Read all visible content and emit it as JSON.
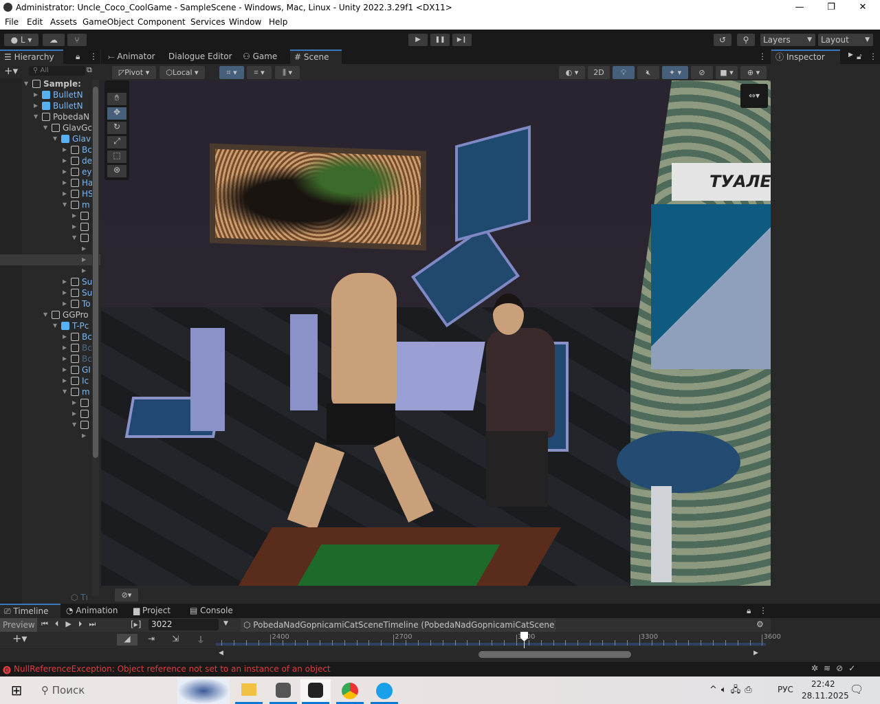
{
  "window": {
    "title": "Administrator: Uncle_Coco_CoolGame - SampleScene - Windows, Mac, Linux - Unity 2022.3.29f1 <DX11>",
    "minimize": "—",
    "maximize": "❐",
    "close": "✕"
  },
  "menu": [
    "File",
    "Edit",
    "Assets",
    "GameObject",
    "Component",
    "Services",
    "Window",
    "Help"
  ],
  "toolbar": {
    "account": "L",
    "layers": "Layers",
    "layout": "Layout",
    "play": "▶",
    "pause": "❚❚",
    "step": "▶❙"
  },
  "hierarchy": {
    "tab": "Hierarchy",
    "search_placeholder": "All",
    "rows": [
      {
        "t": "Sample:",
        "d": 0,
        "k": "scene"
      },
      {
        "t": "BulletN",
        "d": 1,
        "k": "prefab",
        "c": "blue"
      },
      {
        "t": "BulletN",
        "d": 1,
        "k": "prefab",
        "c": "blue"
      },
      {
        "t": "PobedaN",
        "d": 1,
        "k": "obj"
      },
      {
        "t": "GlavGc",
        "d": 2,
        "k": "obj"
      },
      {
        "t": "Glav",
        "d": 3,
        "k": "prefab",
        "c": "blue"
      },
      {
        "t": "Bc",
        "d": 4,
        "k": "obj",
        "c": "blue"
      },
      {
        "t": "de",
        "d": 4,
        "k": "obj",
        "c": "blue"
      },
      {
        "t": "ey",
        "d": 4,
        "k": "obj",
        "c": "blue"
      },
      {
        "t": "Ha",
        "d": 4,
        "k": "obj",
        "c": "blue"
      },
      {
        "t": "HS",
        "d": 4,
        "k": "obj",
        "c": "blue"
      },
      {
        "t": "m",
        "d": 4,
        "k": "obj",
        "c": "blue"
      },
      {
        "t": "",
        "d": 5,
        "k": "obj"
      },
      {
        "t": "",
        "d": 5,
        "k": "obj"
      },
      {
        "t": "",
        "d": 5,
        "k": "obj"
      },
      {
        "t": "",
        "d": 6,
        "k": "none"
      },
      {
        "t": "",
        "d": 6,
        "k": "none",
        "sel": true
      },
      {
        "t": "",
        "d": 6,
        "k": "none"
      },
      {
        "t": "Su",
        "d": 4,
        "k": "obj",
        "c": "blue"
      },
      {
        "t": "Su",
        "d": 4,
        "k": "obj",
        "c": "blue"
      },
      {
        "t": "To",
        "d": 4,
        "k": "obj",
        "c": "blue"
      },
      {
        "t": "GGPro",
        "d": 2,
        "k": "obj"
      },
      {
        "t": "T-Pc",
        "d": 3,
        "k": "prefab",
        "c": "blue"
      },
      {
        "t": "Bc",
        "d": 4,
        "k": "obj",
        "c": "blue"
      },
      {
        "t": "Bc",
        "d": 4,
        "k": "obj",
        "c": "faded"
      },
      {
        "t": "Bc",
        "d": 4,
        "k": "obj",
        "c": "faded"
      },
      {
        "t": "GI",
        "d": 4,
        "k": "obj",
        "c": "blue"
      },
      {
        "t": "Ic",
        "d": 4,
        "k": "obj",
        "c": "blue"
      },
      {
        "t": "m",
        "d": 4,
        "k": "obj",
        "c": "blue"
      },
      {
        "t": "",
        "d": 5,
        "k": "obj"
      },
      {
        "t": "",
        "d": 5,
        "k": "obj"
      },
      {
        "t": "",
        "d": 5,
        "k": "obj"
      },
      {
        "t": "",
        "d": 6,
        "k": "none"
      }
    ],
    "last": "Tı"
  },
  "center_tabs": [
    "Animator",
    "Dialogue Editor",
    "Game",
    "Scene"
  ],
  "scene_toolbar": {
    "pivot": "Pivot",
    "local": "Local",
    "mode2d": "2D"
  },
  "scene_sign": "ТУАЛЕТ",
  "inspector": {
    "tab": "Inspector"
  },
  "bottom_tabs": [
    "Timeline",
    "Animation",
    "Project",
    "Console"
  ],
  "timeline": {
    "preview": "Preview",
    "frame": "3022",
    "asset": "PobedaNadGopnicamiCatSceneTimeline (PobedaNadGopnicamiCatScene)",
    "ruler": [
      "2400",
      "2700",
      "3000",
      "3300",
      "3600"
    ],
    "playhead": 3022
  },
  "status": {
    "error": "NullReferenceException: Object reference not set to an instance of an object",
    "error_color": "#e23b3b"
  },
  "taskbar": {
    "search": "Поиск",
    "lang": "РУС",
    "time": "22:42",
    "date": "28.11.2025"
  }
}
